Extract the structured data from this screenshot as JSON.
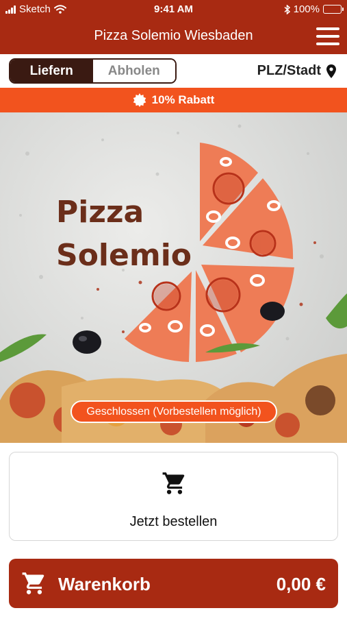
{
  "status_bar": {
    "carrier": "Sketch",
    "time": "9:41 AM",
    "battery": "100%",
    "battery_level": 1.0
  },
  "header": {
    "title": "Pizza Solemio Wiesbaden",
    "menu_icon": "hamburger-menu-icon"
  },
  "mode_toggle": {
    "options": [
      "Liefern",
      "Abholen"
    ],
    "selected": "Liefern"
  },
  "location": {
    "label": "PLZ/Stadt",
    "icon": "map-pin-icon"
  },
  "promo": {
    "text": "10% Rabatt",
    "icon": "badge-star-icon"
  },
  "hero": {
    "logo_line1": "Pizza",
    "logo_line2": "Solemio",
    "status": "Geschlossen (Vorbestellen möglich)"
  },
  "order_card": {
    "label": "Jetzt bestellen",
    "icon": "shopping-cart-icon"
  },
  "cart": {
    "label": "Warenkorb",
    "total": "0,00 €",
    "icon": "shopping-cart-icon"
  },
  "colors": {
    "brand": "#a82a12",
    "accent": "#f2531e",
    "dark": "#3a1a12",
    "logo_text": "#6b2e1a",
    "pizza_logo": "#ee7c56"
  }
}
